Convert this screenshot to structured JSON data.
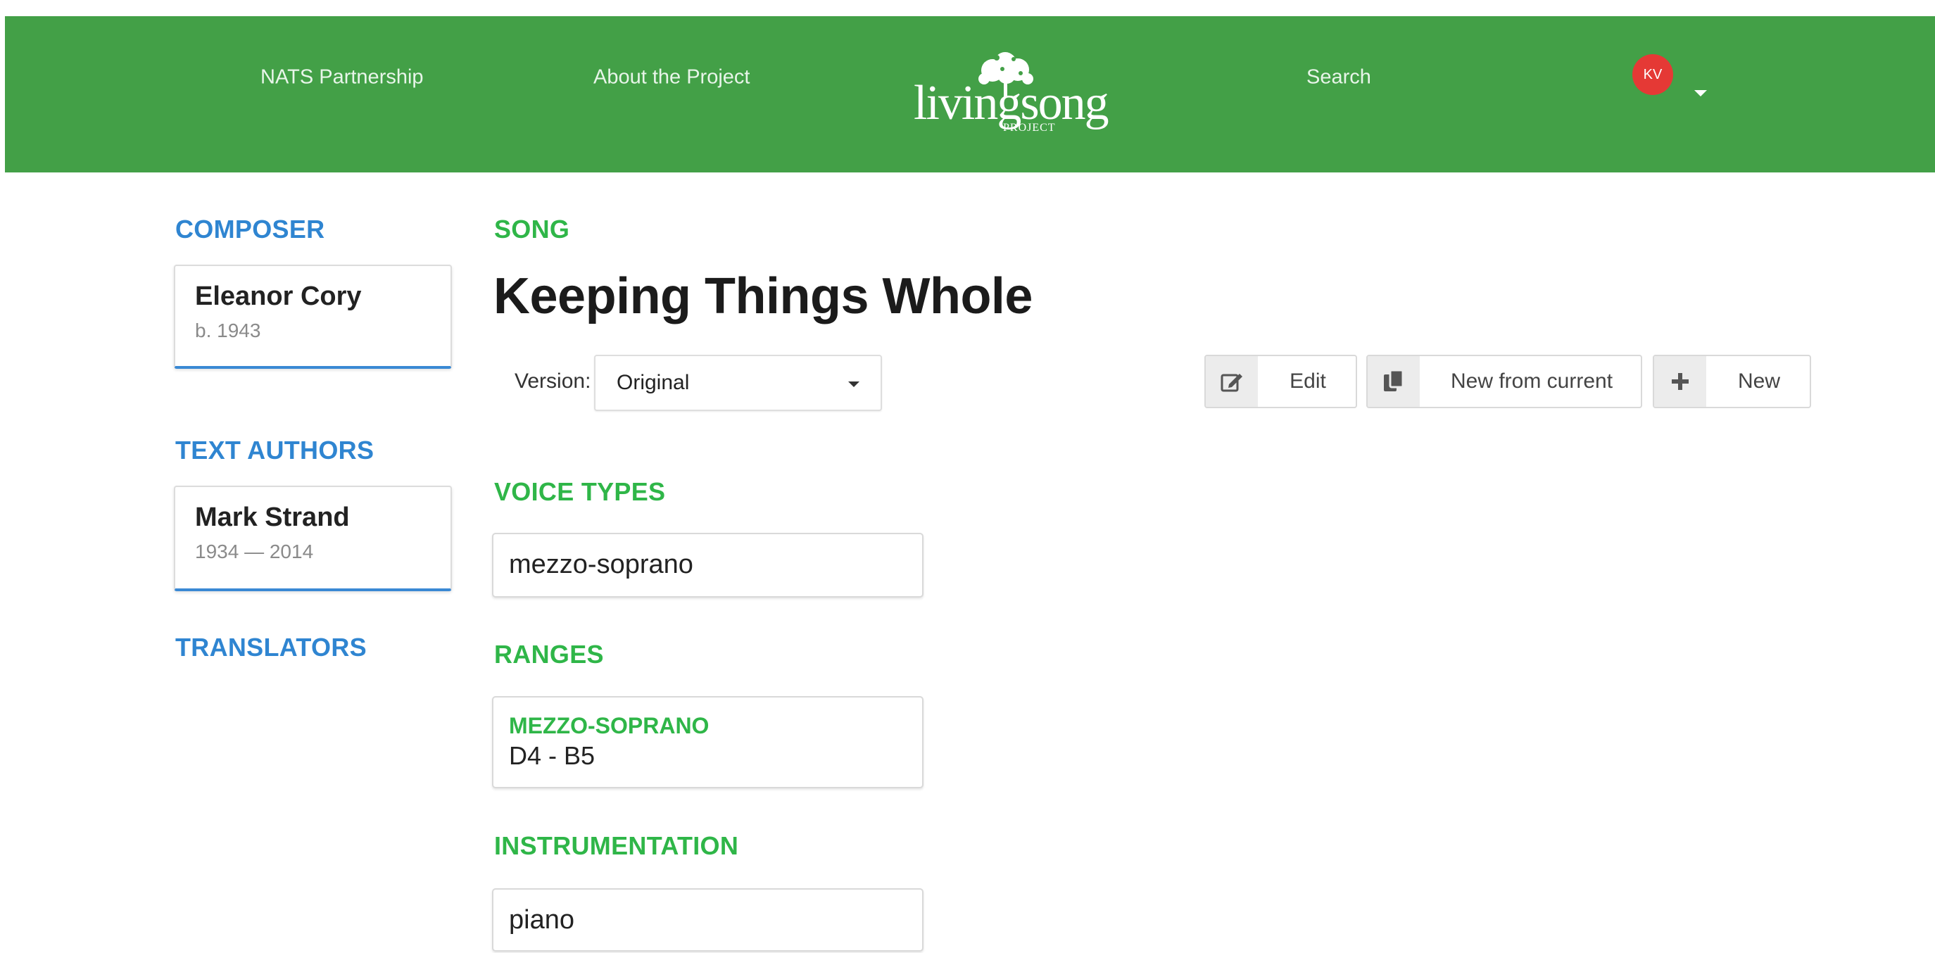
{
  "nav": {
    "nats": "NATS Partnership",
    "about": "About the Project",
    "search": "Search",
    "logo_word": "livingsong",
    "logo_sub": "PROJECT",
    "avatar_initials": "KV"
  },
  "sidebar": {
    "composer_heading": "COMPOSER",
    "composer": {
      "name": "Eleanor Cory",
      "dates": "b. 1943"
    },
    "authors_heading": "TEXT AUTHORS",
    "author": {
      "name": "Mark Strand",
      "dates": "1934  — 2014"
    },
    "translators_heading": "TRANSLATORS"
  },
  "song": {
    "heading": "SONG",
    "title": "Keeping Things Whole",
    "version_label": "Version:",
    "version_value": "Original"
  },
  "actions": {
    "edit": "Edit",
    "new_from_current": "New from current",
    "new": "New"
  },
  "voice_types": {
    "heading": "VOICE TYPES",
    "value": "mezzo-soprano"
  },
  "ranges": {
    "heading": "RANGES",
    "voice": "MEZZO-SOPRANO",
    "value": "D4 - B5"
  },
  "instrumentation": {
    "heading": "INSTRUMENTATION",
    "value": "piano"
  },
  "colors": {
    "header_green": "#43a047",
    "section_blue": "#2f85d1",
    "section_green": "#2fb648",
    "avatar_red": "#e53935"
  }
}
